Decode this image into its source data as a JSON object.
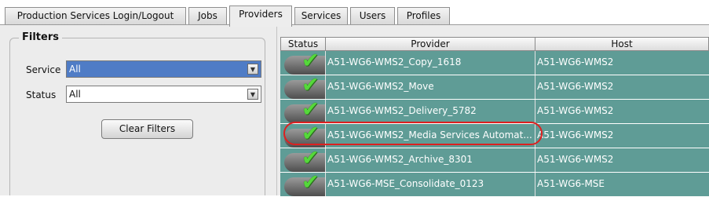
{
  "tabs": [
    {
      "label": "Production Services Login/Logout",
      "active": false
    },
    {
      "label": "Jobs",
      "active": false
    },
    {
      "label": "Providers",
      "active": true
    },
    {
      "label": "Services",
      "active": false
    },
    {
      "label": "Users",
      "active": false
    },
    {
      "label": "Profiles",
      "active": false
    }
  ],
  "filters": {
    "title": "Filters",
    "service": {
      "label": "Service",
      "value": "All"
    },
    "status": {
      "label": "Status",
      "value": "All"
    },
    "clear_label": "Clear Filters"
  },
  "table": {
    "columns": {
      "status": "Status",
      "provider": "Provider",
      "host": "Host"
    },
    "rows": [
      {
        "status": "ok",
        "provider": "A51-WG6-WMS2_Copy_1618",
        "host": "A51-WG6-WMS2"
      },
      {
        "status": "ok",
        "provider": "A51-WG6-WMS2_Move",
        "host": "A51-WG6-WMS2"
      },
      {
        "status": "ok",
        "provider": "A51-WG6-WMS2_Delivery_5782",
        "host": "A51-WG6-WMS2"
      },
      {
        "status": "ok",
        "provider": "A51-WG6-WMS2_Media Services Automat...",
        "host": "A51-WG6-WMS2"
      },
      {
        "status": "ok",
        "provider": "A51-WG6-WMS2_Archive_8301",
        "host": "A51-WG6-WMS2"
      },
      {
        "status": "ok",
        "provider": "A51-WG6-MSE_Consolidate_0123",
        "host": "A51-WG6-MSE"
      }
    ]
  },
  "icons": {
    "status_ok": "green-checkmark-icon",
    "dropdown": "dropdown-arrow-icon"
  },
  "colors": {
    "row_bg": "#5f9c96",
    "highlight": "#dd2020",
    "selected_combo": "#4f7cc6"
  }
}
